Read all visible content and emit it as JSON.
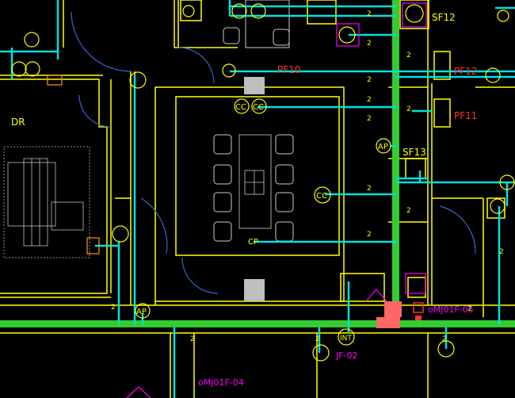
{
  "drawing": {
    "background": "#000000",
    "colors": {
      "wall": "#ffff00",
      "pipe": "#00e0e0",
      "main_duct": "#33cc33",
      "text": "#ffff00",
      "tag_magenta": "#ff00ff",
      "equipment": "#ff3333",
      "door": "#3366cc",
      "fill_gray": "#bfbfbf",
      "furniture": "#cccccc",
      "orange": "#ff9900"
    }
  },
  "labels": {
    "dr": "DR",
    "sf12": "SF12",
    "pf10": "PF10",
    "pf12": "PF12",
    "pf11": "PF11",
    "sf13": "SF13",
    "ap_top": "AP",
    "ap_bottom": "AP",
    "cc_1": "CC",
    "cc_2": "CC",
    "cc_3": "CC",
    "cp": "CP",
    "int": "INT",
    "mj01f05": "oMJ01F-05",
    "mj01f04": "oMJ01F-04",
    "jf02": "JF-02",
    "dim_2": "2"
  }
}
